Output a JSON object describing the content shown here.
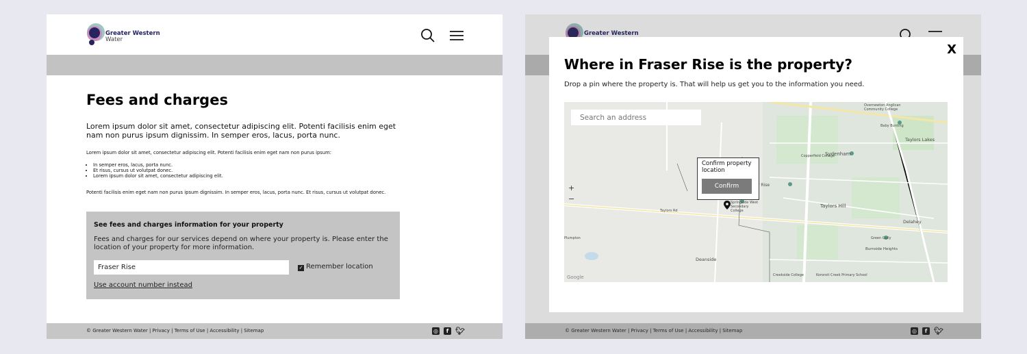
{
  "brand": {
    "name_line1": "Greater Western",
    "name_line2": "Water"
  },
  "left_page": {
    "title": "Fees and charges",
    "lead": "Lorem ipsum dolor sit amet, consectetur adipiscing elit. Potenti facilisis enim eget nam non purus ipsum dignissim. In semper eros, lacus, porta nunc.",
    "intro": "Lorem ipsum dolor sit amet, consectetur adipiscing elit. Potenti facilisis enim eget nam non purus ipsum:",
    "bullets": [
      "In semper eros, lacus, porta nunc.",
      "Et risus, cursus ut volutpat donec.",
      "Lorem ipsum dolor sit amet, consectetur adipiscing elit."
    ],
    "closing": "Potenti facilisis enim eget nam non purus ipsum dignissim. In semper eros, lacus, porta nunc. Et risus, cursus ut volutpat donec.",
    "fee_box": {
      "title": "See fees and charges information for your property",
      "description": "Fees and charges for our services depend on where your property is. Please enter the location of your property for more information.",
      "location_value": "Fraser Rise",
      "remember_label": "Remember location",
      "remember_checked": true,
      "account_link": "Use account number instead"
    }
  },
  "footer": {
    "text": "© Greater Western Water  |  Privacy | Terms of Use | Accessibility | Sitemap",
    "social": [
      "instagram-icon",
      "facebook-icon",
      "twitter-icon"
    ]
  },
  "modal": {
    "close_label": "X",
    "title": "Where in Fraser Rise is the property?",
    "subtitle": "Drop a pin where the property is. That will help us get you to the information you need.",
    "search_placeholder": "Search an address",
    "zoom_in": "+",
    "zoom_out": "−",
    "popup_text": "Confirm property location",
    "confirm_label": "Confirm",
    "map_labels": {
      "sydenham": "Sydenham",
      "taylors_hill": "Taylors Hill",
      "taylors_lakes": "Taylors Lakes",
      "delahey": "Delahey",
      "deanside": "Deanside",
      "burnside_heights": "Burnside Heights",
      "springside": "Springside West Secondary College",
      "copperfield": "Copperfield College",
      "overnewton": "Overnewton Anglican Community College",
      "baby_bunting": "Baby Bunting",
      "green_gully": "Green Gully",
      "plumpton": "Plumpton",
      "taylors_rd": "Taylors Rd",
      "rise": "r Rise",
      "creekside": "Creekside College",
      "kororoit": "Kororoit Creek Primary School",
      "google": "Google"
    }
  },
  "colors": {
    "grey_band": "#c2c2c2",
    "fee_box": "#c4c4c4",
    "footer": "#c6c6c6",
    "brand_dark": "#222266",
    "button": "#7b7b7b"
  }
}
